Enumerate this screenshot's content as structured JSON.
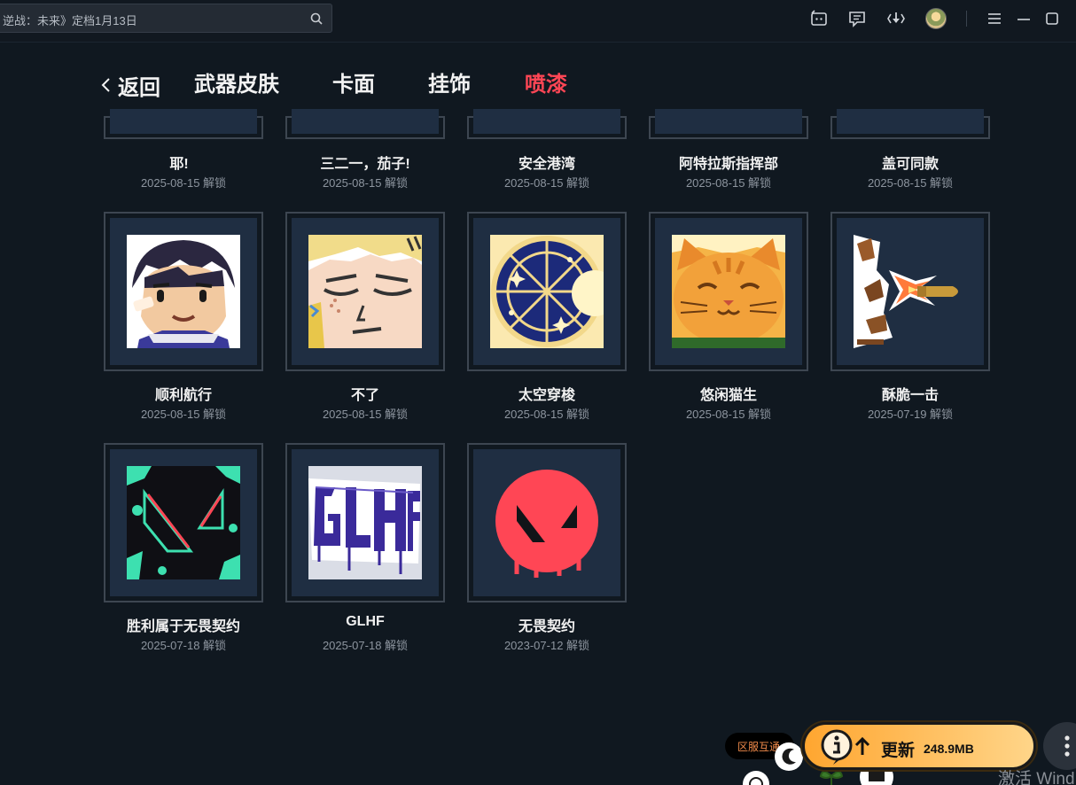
{
  "search": {
    "text": "逆战：未来》定档1月13日"
  },
  "nav": {
    "back_label": "返回",
    "tabs": [
      {
        "label": "武器皮肤",
        "active": false
      },
      {
        "label": "卡面",
        "active": false
      },
      {
        "label": "挂饰",
        "active": false
      },
      {
        "label": "喷漆",
        "active": true
      }
    ]
  },
  "sprays_top_row": [
    {
      "name": "耶!",
      "date": "2025-08-15 解锁"
    },
    {
      "name": "三二一，茄子!",
      "date": "2025-08-15 解锁"
    },
    {
      "name": "安全港湾",
      "date": "2025-08-15 解锁"
    },
    {
      "name": "阿特拉斯指挥部",
      "date": "2025-08-15 解锁"
    },
    {
      "name": "盖可同款",
      "date": "2025-08-15 解锁"
    }
  ],
  "sprays": [
    {
      "name": "顺利航行",
      "date": "2025-08-15 解锁",
      "icon": "smiling-boy-art"
    },
    {
      "name": "不了",
      "date": "2025-08-15 解锁",
      "icon": "closed-eyes-face-art"
    },
    {
      "name": "太空穿梭",
      "date": "2025-08-15 解锁",
      "icon": "space-shuttle-art"
    },
    {
      "name": "悠闲猫生",
      "date": "2025-08-15 解锁",
      "icon": "happy-cat-art"
    },
    {
      "name": "酥脆一击",
      "date": "2025-07-19 解锁",
      "icon": "bullet-burst-art"
    },
    {
      "name": "胜利属于无畏契约",
      "date": "2025-07-18 解锁",
      "icon": "valorant-graffiti-art"
    },
    {
      "name": "GLHF",
      "date": "2025-07-18 解锁",
      "icon": "glhf-graffiti-art"
    },
    {
      "name": "无畏契约",
      "date": "2023-07-12 解锁",
      "icon": "valorant-logo-art"
    }
  ],
  "update": {
    "label": "更新",
    "size": "248.9MB"
  },
  "region_tag": "区服互通",
  "watermark": "激活 Wind",
  "colors": {
    "accent": "#ff4655",
    "update_start": "#ffa630",
    "update_end": "#ffd589",
    "card_bg": "#1f2e42"
  }
}
